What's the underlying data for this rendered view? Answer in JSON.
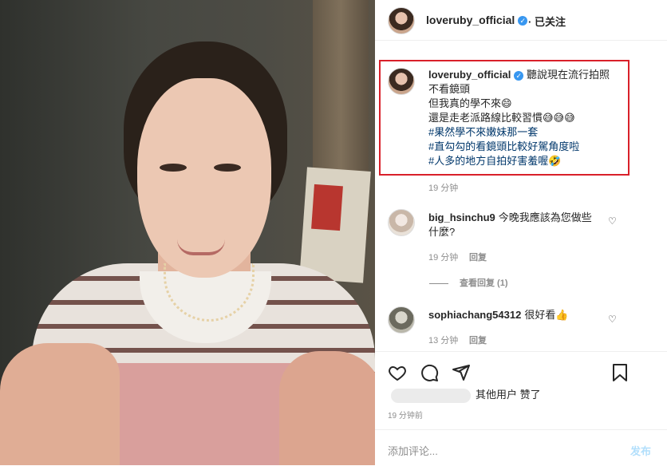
{
  "post": {
    "username": "loveruby_official",
    "follow_status": "· 已关注",
    "verified_mark": "✓"
  },
  "caption": {
    "username": "loveruby_official",
    "lines": [
      "聽說現在流行拍照",
      "不看鏡頭",
      "但我真的學不來😄",
      "還是走老派路線比較習慣😅😅😅"
    ],
    "hashtags": [
      "#果然學不來嫩妹那一套",
      "#直勾勾的看鏡頭比較好駕角度啦",
      "#人多的地方自拍好害羞喔🤣"
    ],
    "time": "19 分钟"
  },
  "comments": [
    {
      "username": "big_hsinchu9",
      "text": "今晚我應該為您做些什麼?",
      "time": "19 分钟",
      "reply": "回复",
      "view_replies": "查看回复 (1)"
    },
    {
      "username": "sophiachang54312",
      "text": "很好看👍",
      "time": "13 分钟",
      "reply": "回复"
    }
  ],
  "likes": {
    "text": "其他用户 赞了"
  },
  "timestamp": "19 分钟前",
  "add_comment": {
    "placeholder": "添加评论...",
    "post_label": "发布"
  },
  "icons": {
    "heart": "heart-icon",
    "comment": "comment-icon",
    "share": "share-icon",
    "bookmark": "bookmark-icon"
  },
  "colors": {
    "highlight_border": "#d9202a",
    "verified": "#3897f0",
    "hashtag": "#00376b",
    "post_button": "#b2dffc"
  }
}
